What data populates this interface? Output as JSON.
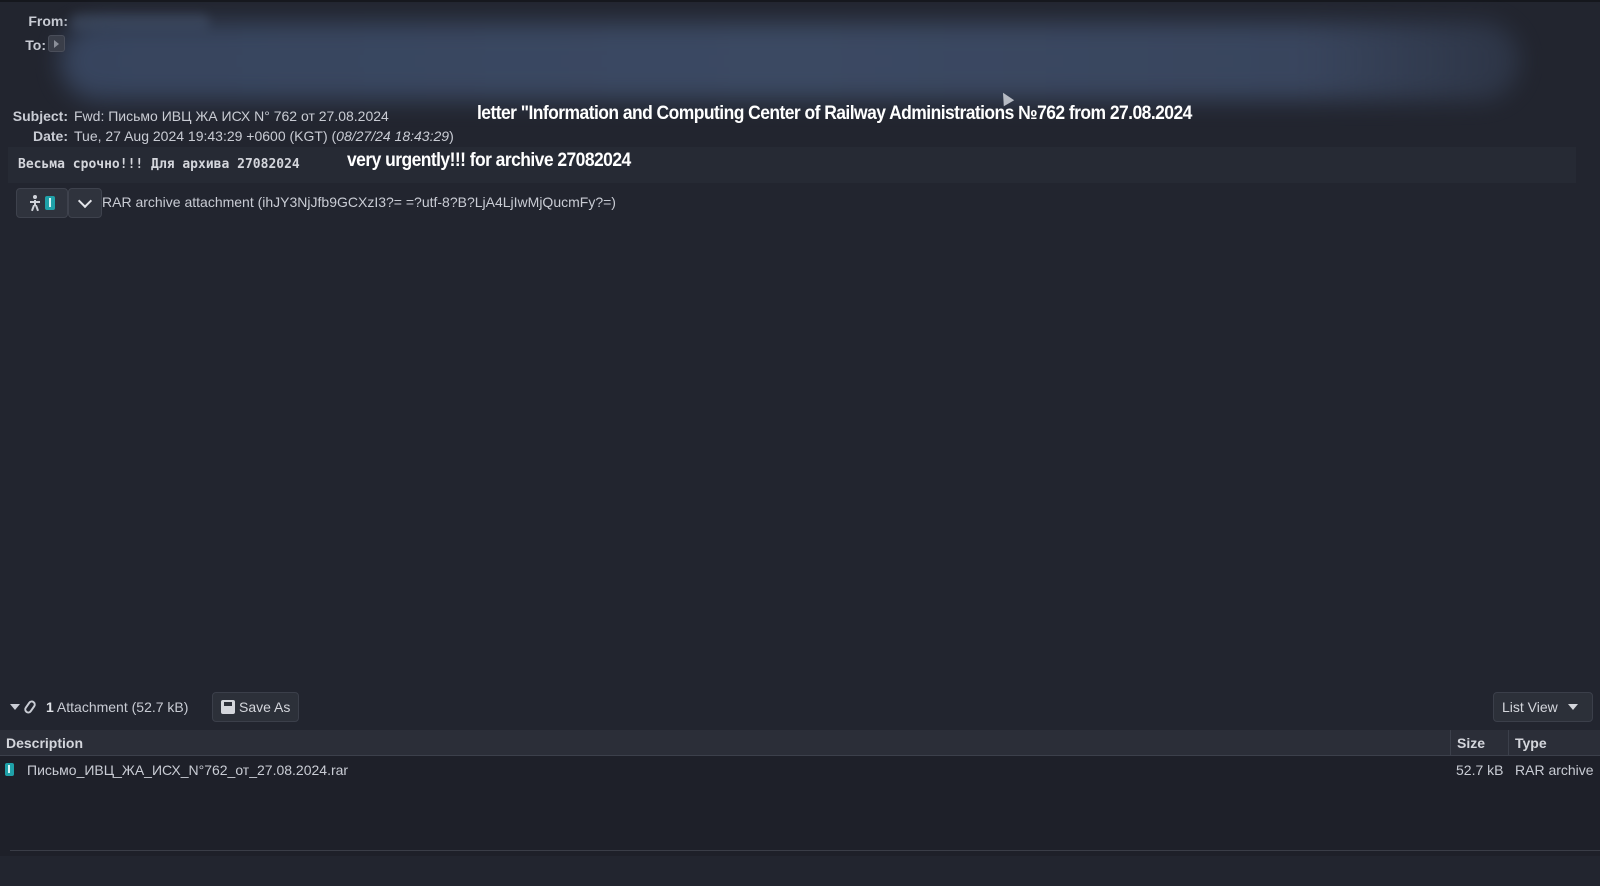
{
  "header": {
    "from_label": "From:",
    "to_label": "To:",
    "subject_label": "Subject:",
    "subject_value": "Fwd: Письмо ИВЦ ЖА ИСХ N° 762 от 27.08.2024",
    "date_label": "Date:",
    "date_value": "Tue, 27 Aug 2024 19:43:29 +0600 (KGT) (",
    "date_alt": "08/27/24 18:43:29",
    "date_close": ")"
  },
  "captions": {
    "subject_translation": "letter \"Information and Computing Center of Railway Administrations №762 from 27.08.2024",
    "body_translation": "very urgently!!! for archive 27082024"
  },
  "message": {
    "body_text": "Весьма срочно!!! Для архива 27082024",
    "inline_attachment": "RAR archive attachment (ihJY3NjJfb9GCXzI3?= =?utf-8?B?LjA4LjIwMjQucmFy?=)"
  },
  "attachments_bar": {
    "count": "1",
    "summary": " Attachment (52.7 kB)",
    "save_as_label": "Save As",
    "view_label": "List View"
  },
  "table": {
    "columns": [
      "Description",
      "Size",
      "Type"
    ],
    "rows": [
      {
        "name": "Письмо_ИВЦ_ЖА_ИСХ_N°762_от_27.08.2024.rar",
        "size": "52.7 kB",
        "type": "RAR archive"
      }
    ]
  },
  "icons": {
    "to_toggle": "expand-triangle-icon",
    "inline_person": "person-icon",
    "inline_archive": "archive-icon",
    "inline_menu": "chevron-down-icon",
    "attachments_toggle": "collapse-triangle-icon",
    "attachments": "paperclip-icon",
    "save": "floppy-disk-icon",
    "file": "archive-file-icon"
  },
  "colors": {
    "background": "#22252f",
    "archive_icon": "#1fa1a8",
    "caption_text": "#ffffff"
  }
}
